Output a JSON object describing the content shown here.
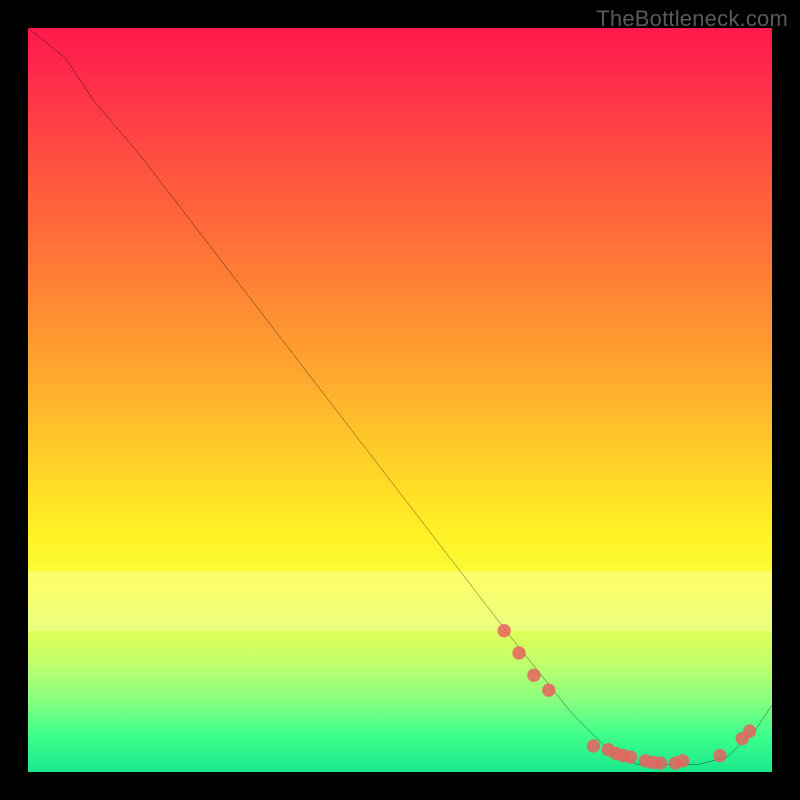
{
  "watermark": "TheBottleneck.com",
  "chart_data": {
    "type": "line",
    "title": "",
    "xlabel": "",
    "ylabel": "",
    "xlim": [
      0,
      100
    ],
    "ylim": [
      0,
      100
    ],
    "grid": false,
    "legend": false,
    "annotations": [],
    "curve": {
      "name": "bottleneck-curve",
      "color": "#000000",
      "x": [
        0,
        5,
        9,
        15,
        25,
        35,
        45,
        55,
        65,
        73,
        78,
        82,
        86,
        90,
        94,
        98,
        100
      ],
      "y": [
        100,
        96,
        90,
        83,
        70,
        57,
        44,
        31,
        18,
        8,
        3,
        1,
        1,
        1,
        2,
        6,
        9
      ]
    },
    "markers": {
      "name": "highlight-points",
      "color": "#e7625f",
      "radius": 6,
      "points": [
        {
          "x": 64,
          "y": 19
        },
        {
          "x": 66,
          "y": 16
        },
        {
          "x": 68,
          "y": 13
        },
        {
          "x": 70,
          "y": 11
        },
        {
          "x": 76,
          "y": 3.5
        },
        {
          "x": 78,
          "y": 3
        },
        {
          "x": 79,
          "y": 2.5
        },
        {
          "x": 80,
          "y": 2.2
        },
        {
          "x": 81,
          "y": 2
        },
        {
          "x": 83,
          "y": 1.5
        },
        {
          "x": 84,
          "y": 1.3
        },
        {
          "x": 85,
          "y": 1.2
        },
        {
          "x": 87,
          "y": 1.2
        },
        {
          "x": 88,
          "y": 1.5
        },
        {
          "x": 93,
          "y": 2.2
        },
        {
          "x": 96,
          "y": 4.5
        },
        {
          "x": 97,
          "y": 5.5
        }
      ]
    },
    "background_gradient": {
      "orientation": "vertical",
      "stops": [
        {
          "pos": 0.0,
          "color": "#ff1a4b"
        },
        {
          "pos": 0.32,
          "color": "#ff7a36"
        },
        {
          "pos": 0.58,
          "color": "#ffd028"
        },
        {
          "pos": 0.75,
          "color": "#faff3a"
        },
        {
          "pos": 0.9,
          "color": "#8cff7e"
        },
        {
          "pos": 1.0,
          "color": "#18e98c"
        }
      ]
    }
  }
}
